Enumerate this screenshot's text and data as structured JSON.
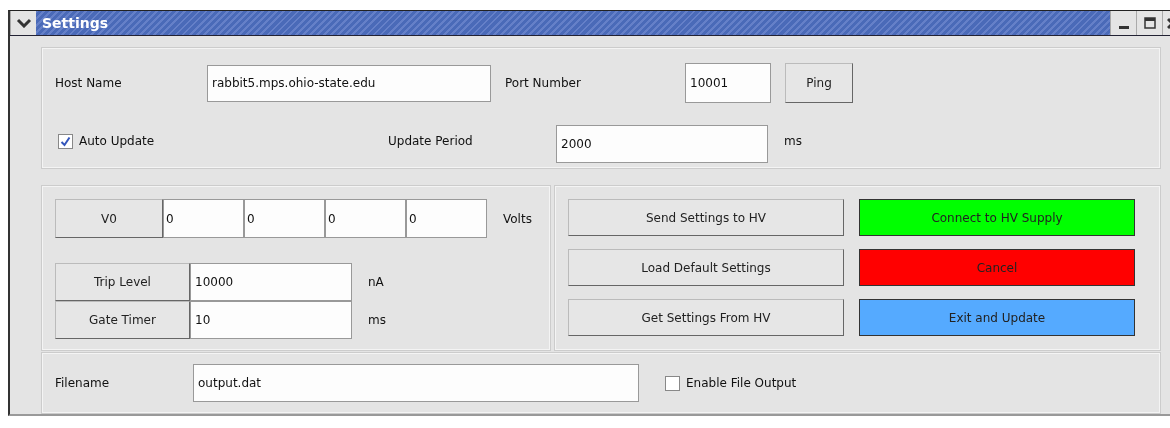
{
  "window": {
    "title": "Settings"
  },
  "connection": {
    "host_label": "Host Name",
    "host_value": "rabbit5.mps.ohio-state.edu",
    "port_label": "Port Number",
    "port_value": "10001",
    "ping_button": "Ping",
    "auto_update": {
      "label": "Auto Update",
      "checked": true
    },
    "period_label": "Update Period",
    "period_value": "2000",
    "period_unit": "ms"
  },
  "voltage": {
    "button": "V0",
    "values": [
      "0",
      "0",
      "0",
      "0"
    ],
    "unit": "Volts"
  },
  "limits": [
    {
      "button": "Trip Level",
      "value": "10000",
      "unit": "nA"
    },
    {
      "button": "Gate Timer",
      "value": "10",
      "unit": "ms"
    }
  ],
  "actions": [
    {
      "label": "Send Settings to HV"
    },
    {
      "label": "Connect to HV Supply",
      "color": "#00ff00"
    },
    {
      "label": "Load Default Settings"
    },
    {
      "label": "Cancel",
      "color": "#ff0000"
    },
    {
      "label": "Get Settings From HV"
    },
    {
      "label": "Exit and Update",
      "color": "#55aaff"
    }
  ],
  "file": {
    "label": "Filename",
    "value": "output.dat",
    "enable": {
      "label": "Enable File Output",
      "checked": false
    }
  }
}
